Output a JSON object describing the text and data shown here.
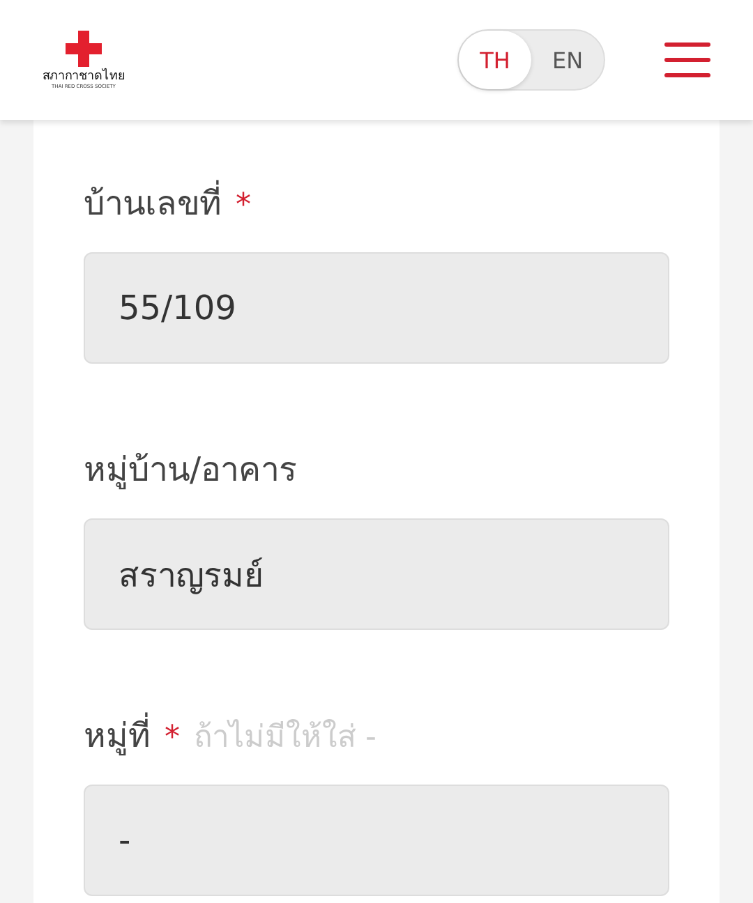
{
  "header": {
    "logo_text": "สภากาชาดไทย",
    "logo_subtext": "THAI RED CROSS SOCIETY",
    "languages": [
      {
        "label": "TH",
        "selected": true
      },
      {
        "label": "EN",
        "selected": false
      }
    ]
  },
  "fields": [
    {
      "label": "บ้านเลขที่",
      "required_mark": "*",
      "value": "55/109"
    },
    {
      "label": "หมู่บ้าน/อาคาร",
      "value": "สราญรมย์"
    },
    {
      "label": "หมู่ที่",
      "required_mark": "*",
      "hint": "ถ้าไม่มีให้ใส่ -",
      "value": "-"
    }
  ]
}
